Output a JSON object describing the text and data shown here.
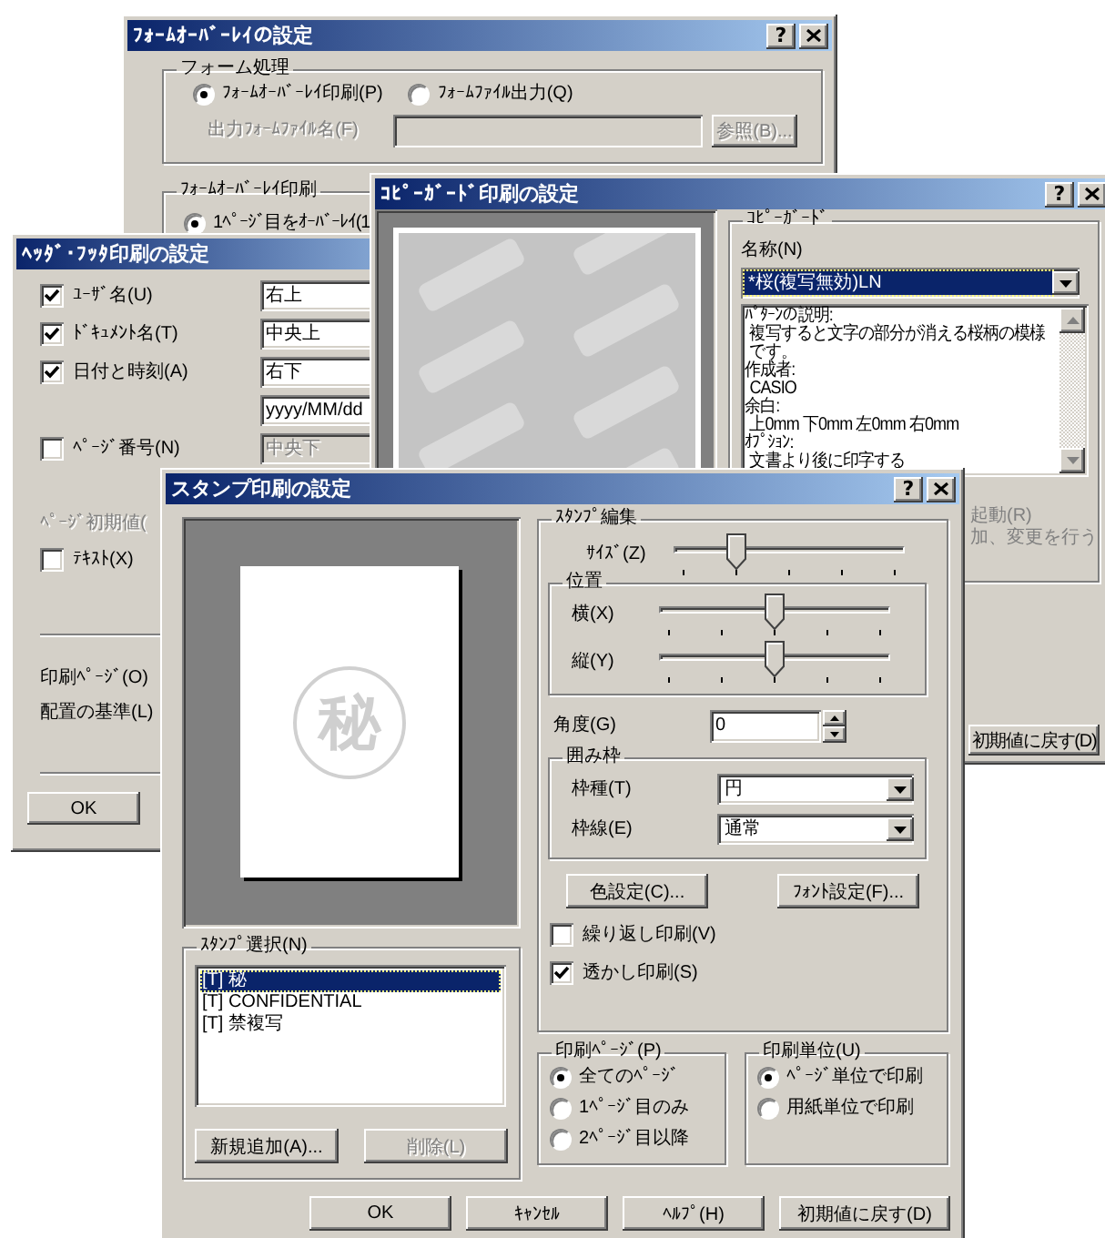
{
  "form_overlay_window": {
    "title": "ﾌｫｰﾑｵｰﾊﾞｰﾚｲの設定",
    "help_button": "?",
    "form_processing": {
      "title": "フォーム処理",
      "options": [
        {
          "label": "ﾌｫｰﾑｵｰﾊﾞｰﾚｲ印刷(P)",
          "selected": true
        },
        {
          "label": "ﾌｫｰﾑﾌｧｲﾙ出力(Q)",
          "selected": false
        }
      ],
      "file_label": "出力ﾌｫｰﾑﾌｧｲﾙ名(F)",
      "file_disabled": true,
      "browse_button": "参照(B)..."
    },
    "overlay_print": {
      "title": "ﾌｫｰﾑｵｰﾊﾞｰﾚｲ印刷",
      "options": [
        {
          "label": "1ﾍﾟｰｼﾞ目をｵｰﾊﾞｰﾚｲ(1",
          "selected": true
        }
      ]
    }
  },
  "header_footer_window": {
    "title": "ﾍｯﾀﾞ･ﾌｯﾀ印刷の設定",
    "items": [
      {
        "label": "ﾕｰｻﾞ名(U)",
        "checked": true,
        "values": [
          "右上"
        ],
        "field_disabled": false
      },
      {
        "label": "ﾄﾞｷｭﾒﾝﾄ名(T)",
        "checked": true,
        "values": [
          "中央上"
        ],
        "field_disabled": false
      },
      {
        "label": "日付と時刻(A)",
        "checked": true,
        "values": [
          "右下",
          "yyyy/MM/dd"
        ],
        "field_disabled": false
      },
      {
        "label": "ﾍﾟｰｼﾞ番号(N)",
        "checked": false,
        "values": [
          "中央下"
        ],
        "field_disabled": true
      }
    ],
    "page_start_label": "ﾍﾟｰｼﾞ初期値(",
    "text_option": {
      "label": "ﾃｷｽﾄ(X)",
      "checked": false
    },
    "print_pages_label": "印刷ﾍﾟｰｼﾞ(O)",
    "placement_label": "配置の基準(L)",
    "ok_button": "OK"
  },
  "copyguard_window": {
    "title": "ｺﾋﾟｰｶﾞｰﾄﾞ印刷の設定",
    "help_button": "?",
    "group_title": "ｺﾋﾟｰｶﾞｰﾄﾞ",
    "name_label": "名称(N)",
    "name_value": "*桜(複写無効)LN",
    "description": [
      {
        "text": "ﾊﾟﾀｰﾝの説明:",
        "kind": "heading"
      },
      {
        "text": "複写すると文字の部分が消える桜柄の模様",
        "kind": "detail"
      },
      {
        "text": "です。",
        "kind": "detail"
      },
      {
        "text": "作成者:",
        "kind": "heading"
      },
      {
        "text": "CASIO",
        "kind": "detail"
      },
      {
        "text": "余白:",
        "kind": "heading"
      },
      {
        "text": "上0mm 下0mm 左0mm 右0mm",
        "kind": "detail"
      },
      {
        "text": "ｵﾌﾟｼｮﾝ:",
        "kind": "heading"
      },
      {
        "text": "文書より後に印字する",
        "kind": "detail"
      }
    ],
    "partial_lines": [
      "起動(R)",
      "加、変更を行う"
    ],
    "reset_button": "初期値に戻す(D)"
  },
  "stamp_window": {
    "title": "スタンプ印刷の設定",
    "help_button": "?",
    "preview_text": "秘",
    "stamp_select": {
      "title": "ｽﾀﾝﾌﾟ選択(N)",
      "items": [
        {
          "label": "[T] 秘",
          "selected": true
        },
        {
          "label": "[T] CONFIDENTIAL",
          "selected": false
        },
        {
          "label": "[T] 禁複写",
          "selected": false
        }
      ],
      "buttons": [
        {
          "label": "新規追加(A)...",
          "disabled": false
        },
        {
          "label": "削除(L)",
          "disabled": true
        }
      ]
    },
    "stamp_edit": {
      "title": "ｽﾀﾝﾌﾟ編集",
      "size": {
        "label": "ｻｲｽﾞ(Z)",
        "level": 0.25
      },
      "position": {
        "title": "位置",
        "sliders": [
          {
            "label": "横(X)",
            "level": 0.5
          },
          {
            "label": "縦(Y)",
            "level": 0.5
          }
        ]
      },
      "angle": {
        "label": "角度(G)",
        "value": "0"
      },
      "frame": {
        "title": "囲み枠",
        "fields": [
          {
            "label": "枠種(T)",
            "value": "円"
          },
          {
            "label": "枠線(E)",
            "value": "通常"
          }
        ]
      },
      "buttons": [
        "色設定(C)...",
        "ﾌｫﾝﾄ設定(F)..."
      ],
      "options": [
        {
          "label": "繰り返し印刷(V)",
          "checked": false
        },
        {
          "label": "透かし印刷(S)",
          "checked": true
        }
      ]
    },
    "print_pages": {
      "title": "印刷ﾍﾟｰｼﾞ(P)",
      "options": [
        {
          "label": "全てのﾍﾟｰｼﾞ",
          "selected": true
        },
        {
          "label": "1ﾍﾟｰｼﾞ目のみ",
          "selected": false
        },
        {
          "label": "2ﾍﾟｰｼﾞ目以降",
          "selected": false
        }
      ]
    },
    "print_unit": {
      "title": "印刷単位(U)",
      "options": [
        {
          "label": "ﾍﾟｰｼﾞ単位で印刷",
          "selected": true
        },
        {
          "label": "用紙単位で印刷",
          "selected": false
        }
      ]
    },
    "buttons": [
      "OK",
      "ｷｬﾝｾﾙ",
      "ﾍﾙﾌﾟ(H)",
      "初期値に戻す(D)"
    ]
  }
}
